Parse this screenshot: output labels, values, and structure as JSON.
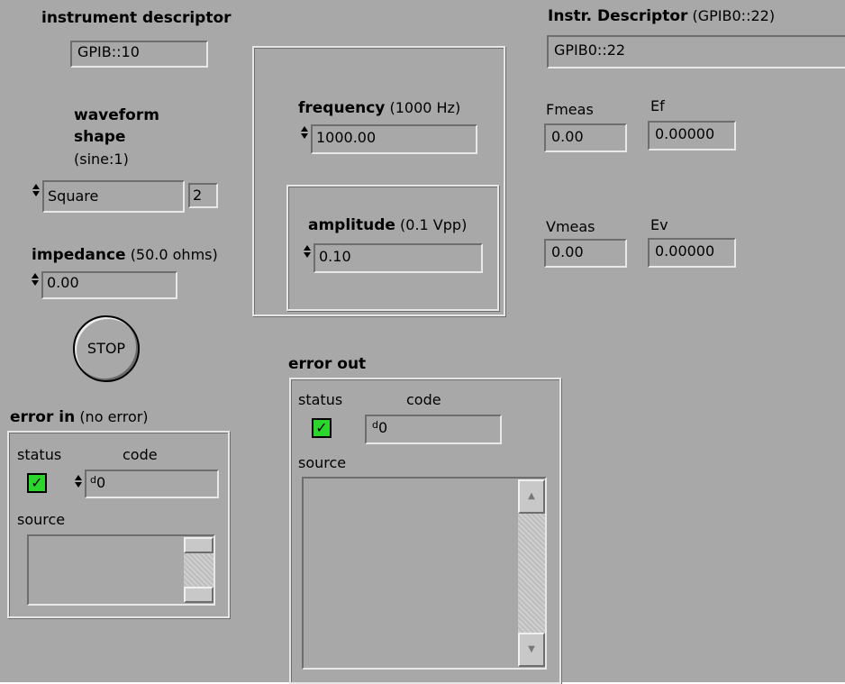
{
  "instrument_descriptor": {
    "label": "instrument descriptor",
    "value": "GPIB::10"
  },
  "instr_descriptor_right": {
    "label": "Instr. Descriptor",
    "default": "(GPIB0::22)",
    "value": "GPIB0::22"
  },
  "waveform_shape": {
    "label_line1": "waveform",
    "label_line2": "shape",
    "default": "(sine:1)",
    "value": "Square",
    "index": "2"
  },
  "impedance": {
    "label": "impedance",
    "default": "(50.0 ohms)",
    "value": "0.00"
  },
  "frequency": {
    "label": "frequency",
    "default": "(1000 Hz)",
    "value": "1000.00"
  },
  "amplitude": {
    "label": "amplitude",
    "default": "(0.1 Vpp)",
    "value": "0.10"
  },
  "measurements": {
    "fmeas": {
      "label": "Fmeas",
      "value": "0.00"
    },
    "ef": {
      "label": "Ef",
      "value": "0.00000"
    },
    "vmeas": {
      "label": "Vmeas",
      "value": "0.00"
    },
    "ev": {
      "label": "Ev",
      "value": "0.00000"
    }
  },
  "stop_button": {
    "label": "STOP"
  },
  "error_in": {
    "label": "error in",
    "default": "(no error)",
    "status_label": "status",
    "code_label": "code",
    "code_radix": "d",
    "code_value": "0",
    "source_label": "source",
    "status_mark": "✓"
  },
  "error_out": {
    "label": "error out",
    "status_label": "status",
    "code_label": "code",
    "code_radix": "d",
    "code_value": "0",
    "source_label": "source",
    "status_mark": "✓"
  },
  "colors": {
    "panel_bg": "#a8a8a8",
    "status_ok": "#2bd52b"
  }
}
